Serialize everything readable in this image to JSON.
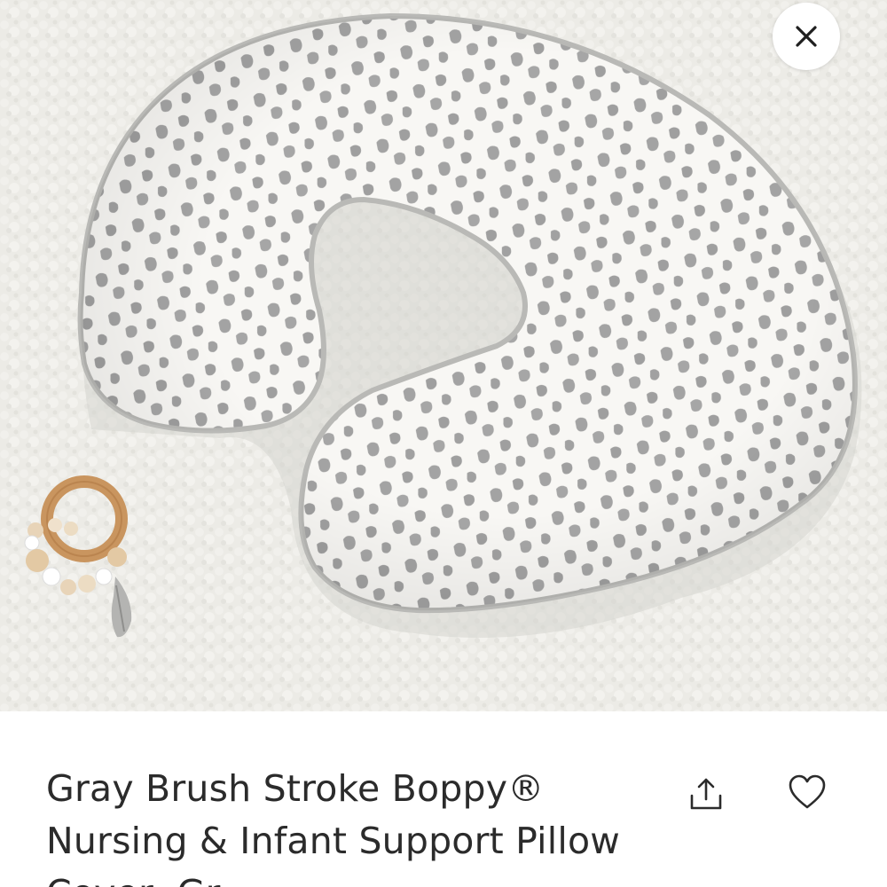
{
  "product": {
    "title_line1": "Gray Brush Stroke Boppy®",
    "title_line2": "Nursing & Infant Support Pillow",
    "title_line3": "Cover, Gr..."
  },
  "icons": {
    "close": "close-icon",
    "share": "share-icon",
    "favorite": "heart-icon"
  },
  "colors": {
    "text": "#2b2b2b",
    "pillow": "#f7f6f3",
    "spots": "#9b9b9b",
    "carpet": "#ecebe7"
  }
}
